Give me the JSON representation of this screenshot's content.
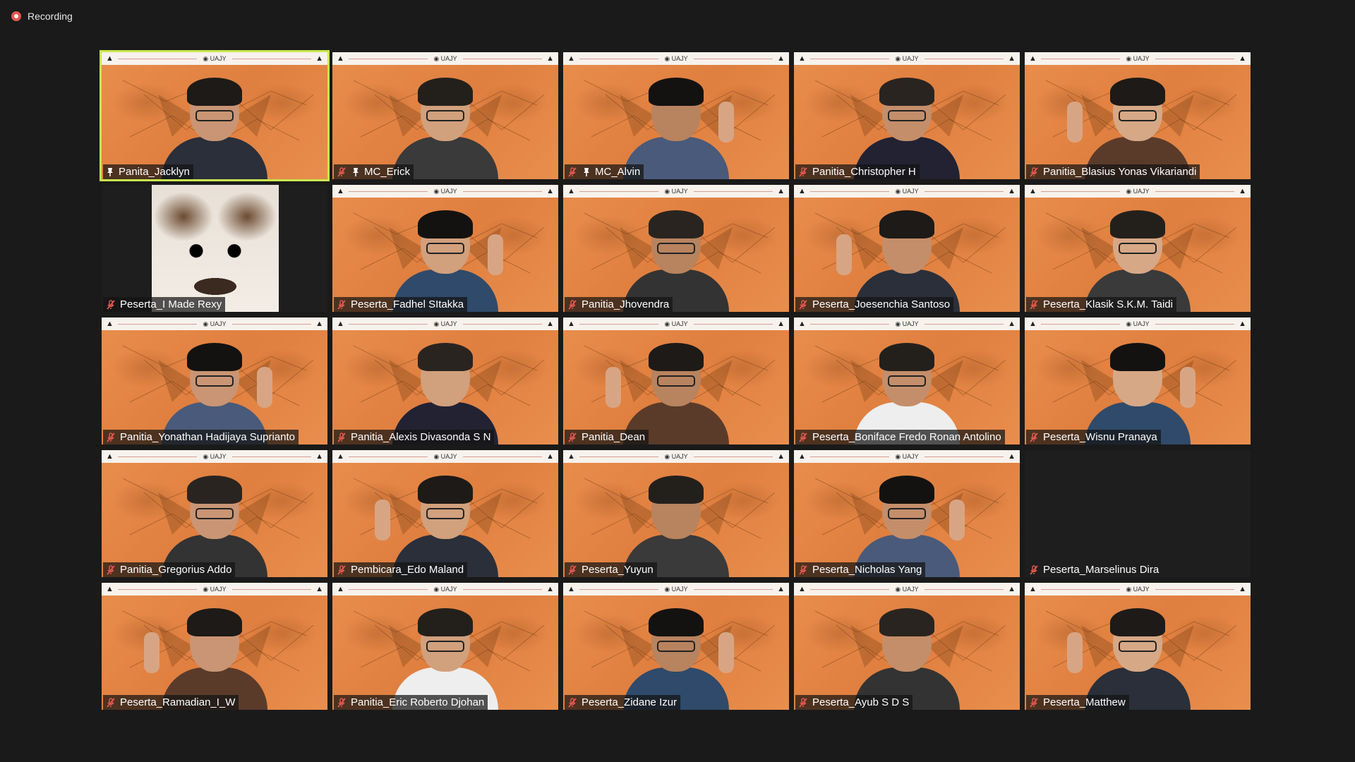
{
  "recording": {
    "label": "Recording"
  },
  "participants": [
    {
      "name": "Panita_Jacklyn",
      "muted": false,
      "pinned": true,
      "active": true,
      "type": "video"
    },
    {
      "name": "MC_Erick",
      "muted": true,
      "pinned": true,
      "type": "video"
    },
    {
      "name": "MC_Alvin",
      "muted": true,
      "pinned": true,
      "type": "video"
    },
    {
      "name": "Panitia_Christopher H",
      "muted": true,
      "type": "video"
    },
    {
      "name": "Panitia_Blasius Yonas Vikariandi",
      "muted": true,
      "type": "video"
    },
    {
      "name": "Peserta_I Made Rexy",
      "muted": true,
      "type": "cat"
    },
    {
      "name": "Peserta_Fadhel SItakka",
      "muted": true,
      "type": "video"
    },
    {
      "name": "Panitia_Jhovendra",
      "muted": true,
      "type": "video"
    },
    {
      "name": "Peserta_Joesenchia Santoso",
      "muted": true,
      "type": "video"
    },
    {
      "name": "Peserta_Klasik S.K.M. Taidi",
      "muted": true,
      "type": "video"
    },
    {
      "name": "Panitia_Yonathan Hadijaya Suprianto",
      "muted": true,
      "type": "video"
    },
    {
      "name": "Panitia_Alexis Divasonda S N",
      "muted": true,
      "type": "video"
    },
    {
      "name": "Panitia_Dean",
      "muted": true,
      "type": "video"
    },
    {
      "name": "Peserta_Boniface Fredo Ronan Antolino",
      "muted": true,
      "type": "video"
    },
    {
      "name": "Peserta_Wisnu Pranaya",
      "muted": true,
      "type": "video"
    },
    {
      "name": "Panitia_Gregorius Addo",
      "muted": true,
      "type": "video"
    },
    {
      "name": "Pembicara_Edo Maland",
      "muted": true,
      "type": "video"
    },
    {
      "name": "Peserta_Yuyun",
      "muted": true,
      "type": "video"
    },
    {
      "name": "Peserta_Nicholas Yang",
      "muted": true,
      "type": "video"
    },
    {
      "name": "Peserta_Marselinus Dira",
      "muted": true,
      "type": "empty"
    },
    {
      "name": "Peserta_Ramadian_I_W",
      "muted": true,
      "type": "video"
    },
    {
      "name": "Panitia_Eric Roberto Djohan",
      "muted": true,
      "type": "video"
    },
    {
      "name": "Peserta_Zidane Izur",
      "muted": true,
      "type": "video"
    },
    {
      "name": "Peserta_Ayub S D S",
      "muted": true,
      "type": "video"
    },
    {
      "name": "Peserta_Matthew",
      "muted": true,
      "type": "video"
    }
  ],
  "banner": {
    "logo_text": "UAJY"
  },
  "colors": {
    "background": "#1a1a1a",
    "tile_orange": "#e6884a",
    "active_speaker": "#c9e84f",
    "mute_red": "#e0574f"
  },
  "icons": {
    "muted": "microphone-muted-icon",
    "pinned": "pin-icon",
    "recording": "recording-dot-icon"
  }
}
